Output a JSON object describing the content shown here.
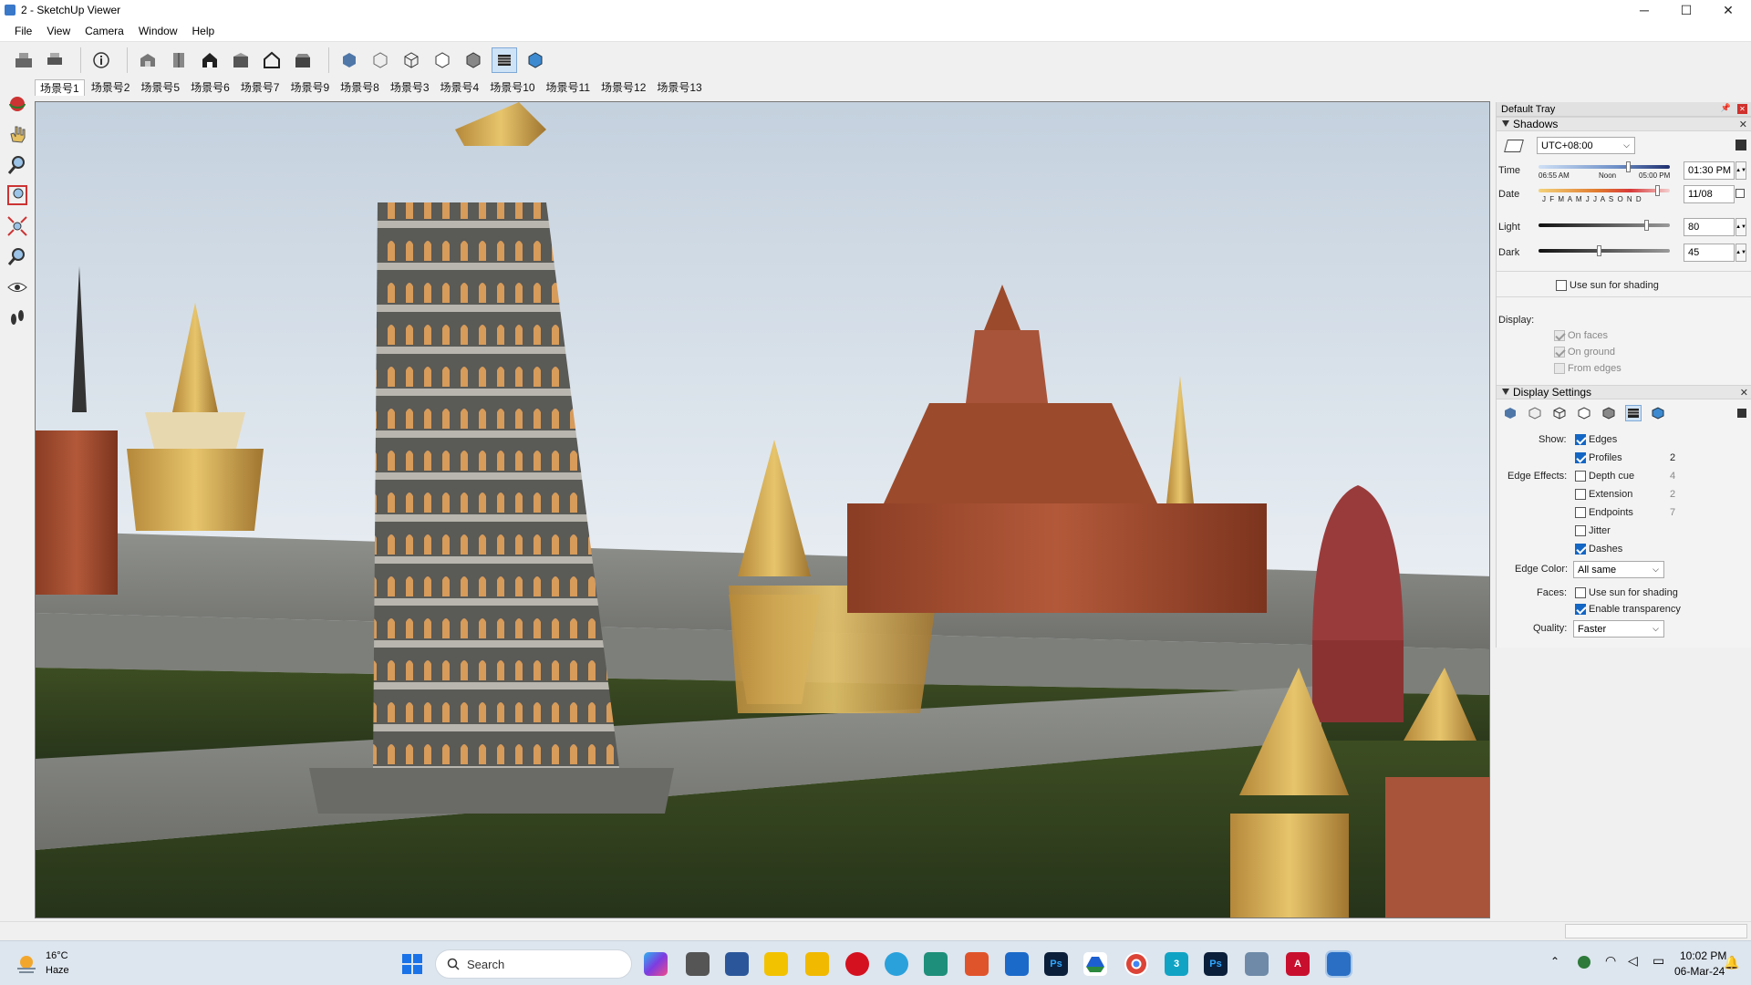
{
  "window": {
    "title": "2 - SketchUp Viewer",
    "minimize": "─",
    "maximize": "☐",
    "close": "✕"
  },
  "menu": [
    "File",
    "View",
    "Camera",
    "Window",
    "Help"
  ],
  "scenes": [
    "场景号1",
    "场景号2",
    "场景号5",
    "场景号6",
    "场景号7",
    "场景号9",
    "场景号8",
    "场景号3",
    "场景号4",
    "场景号10",
    "场景号11",
    "场景号12",
    "场景号13"
  ],
  "tray": {
    "title": "Default Tray",
    "shadows": {
      "header": "Shadows",
      "timezone": "UTC+08:00",
      "time_label": "Time",
      "time_start": "06:55 AM",
      "time_noon": "Noon",
      "time_end": "05:00 PM",
      "time_value": "01:30 PM",
      "date_label": "Date",
      "months": "J F M A M J J A S O N D",
      "date_value": "11/08",
      "light_label": "Light",
      "light_value": "80",
      "dark_label": "Dark",
      "dark_value": "45",
      "use_sun": "Use sun for shading",
      "display_label": "Display:",
      "on_faces": "On faces",
      "on_ground": "On ground",
      "from_edges": "From edges"
    },
    "display_settings": {
      "header": "Display Settings",
      "show_label": "Show:",
      "edges": "Edges",
      "profiles": "Profiles",
      "profiles_val": "2",
      "edge_effects_label": "Edge Effects:",
      "depth_cue": "Depth cue",
      "depth_cue_val": "4",
      "extension": "Extension",
      "extension_val": "2",
      "endpoints": "Endpoints",
      "endpoints_val": "7",
      "jitter": "Jitter",
      "dashes": "Dashes",
      "edge_color_label": "Edge Color:",
      "edge_color_value": "All same",
      "faces_label": "Faces:",
      "faces_use_sun": "Use sun for shading",
      "enable_transparency": "Enable transparency",
      "quality_label": "Quality:",
      "quality_value": "Faster"
    }
  },
  "taskbar": {
    "weather_temp": "16°C",
    "weather_desc": "Haze",
    "search_placeholder": "Search",
    "time": "10:02 PM",
    "date": "06-Mar-24"
  }
}
